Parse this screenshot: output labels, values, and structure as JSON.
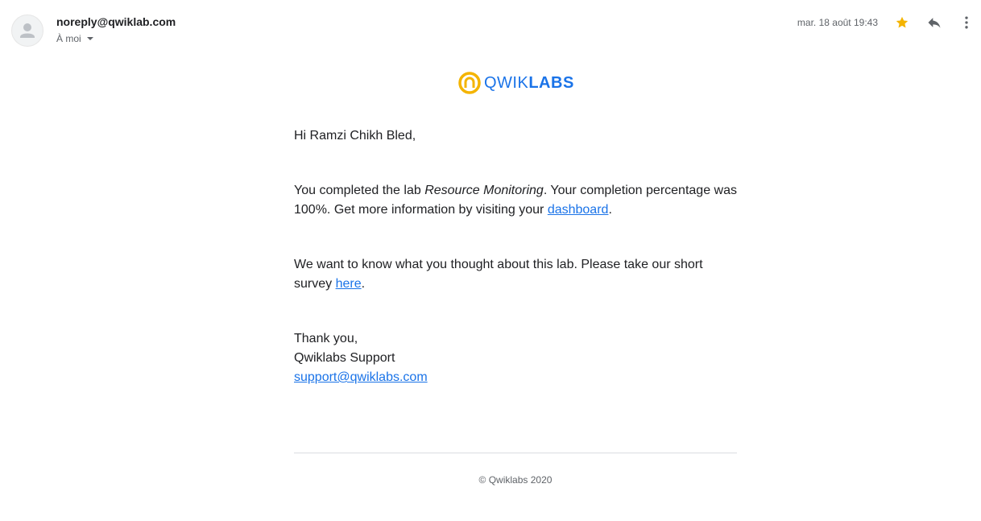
{
  "header": {
    "sender": "noreply@qwiklab.com",
    "recipient": "À moi",
    "date": "mar. 18 août 19:43",
    "icons": {
      "avatar": "person-avatar-icon",
      "star": "star-icon",
      "reply": "reply-icon",
      "more": "more-vert-icon"
    },
    "star_color": "#f4b400"
  },
  "logo": {
    "part1": "QWIK",
    "part2": "LABS",
    "mark_color": "#f4b400",
    "text_color": "#1a73e8"
  },
  "body": {
    "greeting": "Hi Ramzi Chikh Bled,",
    "completed_prefix": "You completed the lab ",
    "lab_name": "Resource Monitoring",
    "completed_middle": ". Your completion percentage was 100%. Get more information by visiting your ",
    "dashboard_link": "dashboard",
    "completed_suffix": ".",
    "survey_prefix": "We want to know what you thought about this lab. Please take our short survey ",
    "survey_link": "here",
    "survey_suffix": ".",
    "thanks": "Thank you,",
    "signature": "Qwiklabs Support",
    "support_email": "support@qwiklabs.com"
  },
  "footer": {
    "copyright": "© Qwiklabs 2020"
  }
}
